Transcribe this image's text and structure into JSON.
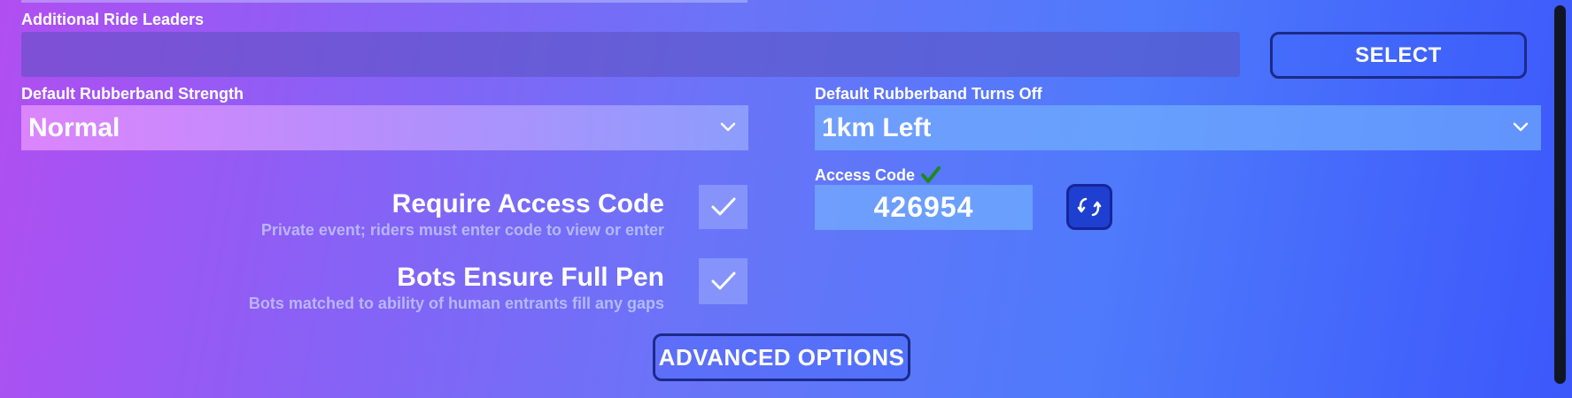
{
  "ride_leaders": {
    "label": "Additional Ride Leaders",
    "value": "",
    "select_label": "SELECT"
  },
  "rubberband_strength": {
    "label": "Default Rubberband Strength",
    "value": "Normal"
  },
  "rubberband_off": {
    "label": "Default Rubberband Turns Off",
    "value": "1km Left"
  },
  "access_code": {
    "label": "Access Code",
    "value": "426954",
    "valid_icon": "check-icon",
    "refresh_icon": "refresh-icon"
  },
  "options": [
    {
      "title": "Require Access Code",
      "description": "Private event; riders must enter code to view or enter",
      "checked": true
    },
    {
      "title": "Bots Ensure Full Pen",
      "description": "Bots matched to ability of human entrants fill any gaps",
      "checked": true
    }
  ],
  "advanced_label": "ADVANCED OPTIONS",
  "colors": {
    "accent_border": "#1b2a8a",
    "valid_check": "#1d8a1d",
    "refresh_bg": "#1f3fd0"
  }
}
